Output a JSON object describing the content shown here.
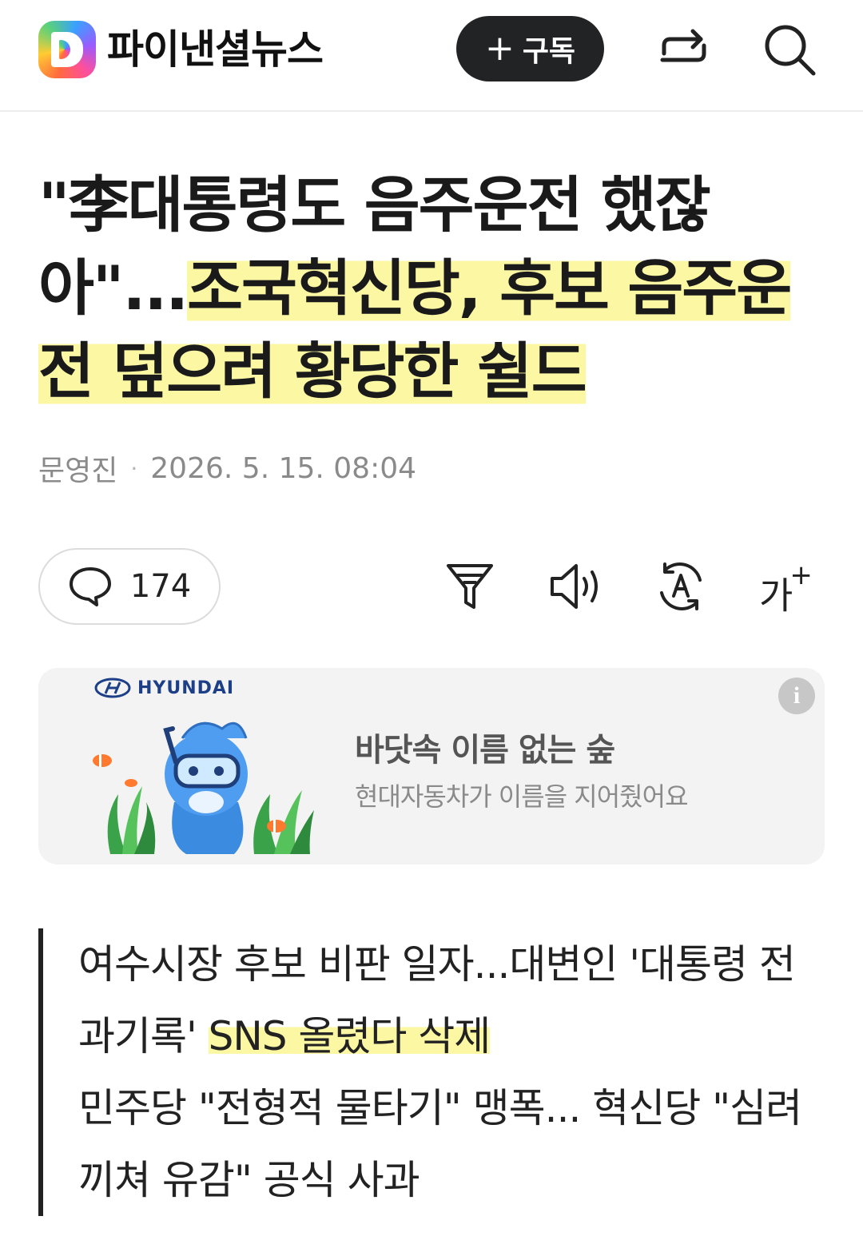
{
  "header": {
    "brand_name": "파이낸셜뉴스",
    "subscribe_label": "구독",
    "subscribe_plus": "+",
    "share_icon": "share-icon",
    "search_icon": "search-icon"
  },
  "article": {
    "title_part1": "\"李대통령도 음주운전 했잖아\"...",
    "title_highlight": "조국혁신당, 후보 음주운전 덮으려 황당한 쉴드",
    "author": "문영진",
    "separator": "·",
    "datetime": "2026. 5. 15. 08:04"
  },
  "toolbar": {
    "comment_count": "174",
    "filter_icon": "summary-filter-icon",
    "audio_icon": "speaker-icon",
    "translate_icon": "translate-icon",
    "font_size_label": "가",
    "font_size_plus": "+"
  },
  "ad": {
    "brand": "HYUNDAI",
    "title": "바닷속 이름 없는 숲",
    "subtitle": "현대자동차가 이름을 지어줬어요",
    "info_label": "i"
  },
  "summary": {
    "line1_start": "여수시장 후보 비판 일자...대변인 '대통령 전과기록' ",
    "line1_highlight": "SNS 올렸다 삭제",
    "line2": "민주당 \"전형적 물타기\" 맹폭... 혁신당 \"심려 끼쳐 유감\" 공식 사과"
  },
  "colors": {
    "highlight": "#fbf7a3",
    "subscribe_bg": "#222325",
    "ad_bg": "#f3f3f3"
  }
}
